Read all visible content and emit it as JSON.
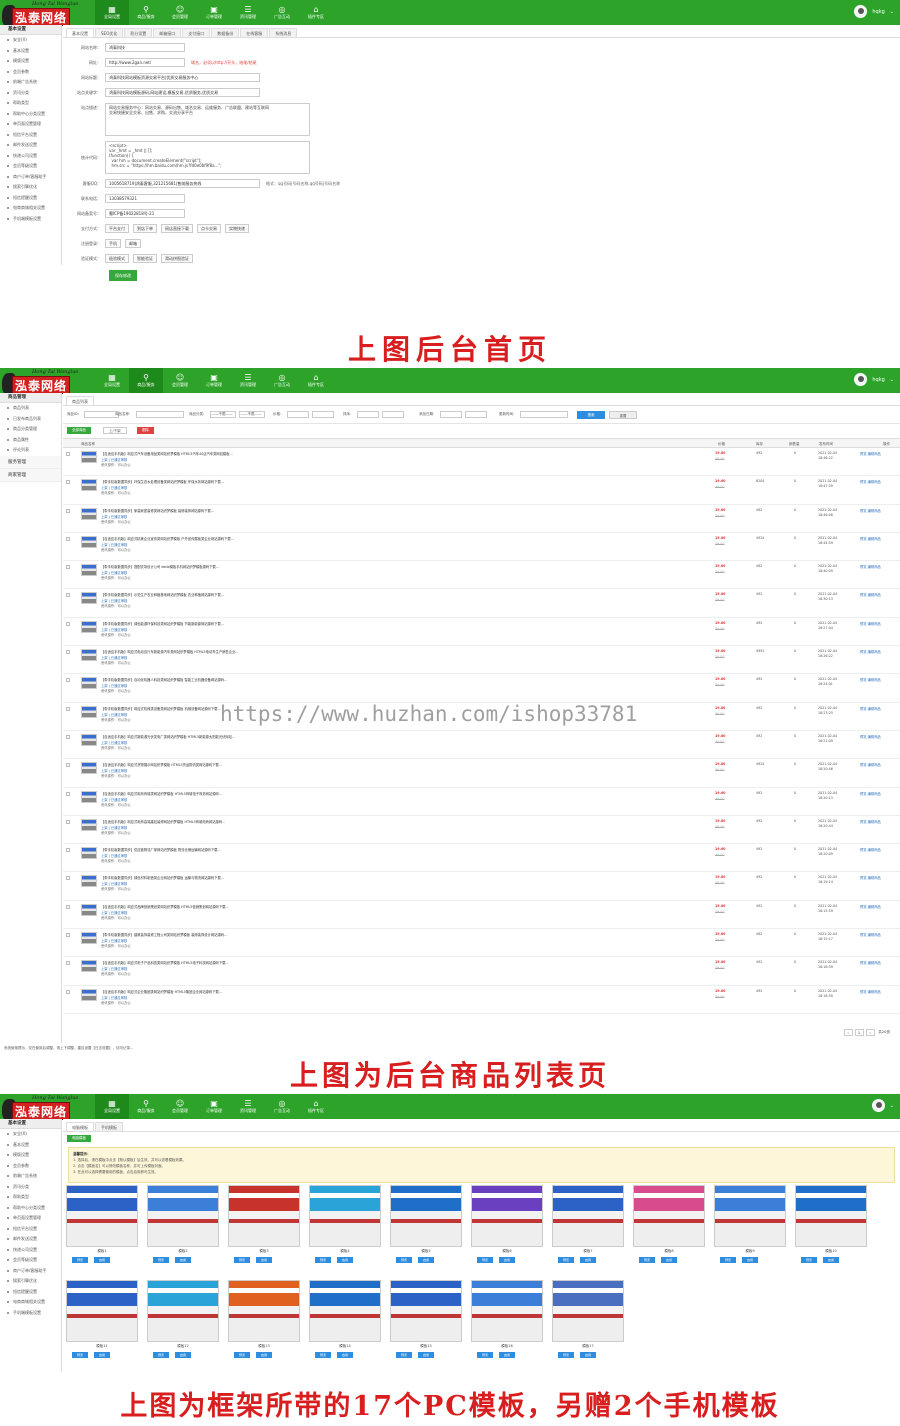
{
  "brand": {
    "kanji": "泓泰网络",
    "signature": "Hong Tai Wangluo"
  },
  "nav": [
    "全局设置",
    "商品/服务",
    "会员管理",
    "订单管理",
    "资讯管理",
    "广告互动",
    "插件专区"
  ],
  "user": {
    "name": "hqkg",
    "caret": "⌄"
  },
  "panel1": {
    "side_head": "基本设置",
    "side_items": [
      "安全(X)",
      "基本设置",
      "模版设置",
      "会员参数",
      "前端广告系统",
      "资讯分类",
      "帮助类型",
      "帮助中心分类设置",
      "单页面设置管理",
      "短信平台设置",
      "邮件发送设置",
      "快递公司设置",
      "会员等级设置",
      "商户订单/客服助手",
      "搜索引擎优化",
      "短信提醒设置",
      "电商商城相关设置",
      "手机端模板设置"
    ],
    "tabs": [
      "基本设置",
      "SEO优化",
      "积分设置",
      "邮箱接口",
      "支付接口",
      "数据备份",
      "在线客服",
      "系统消息"
    ],
    "fields": [
      {
        "label": "网站名称：",
        "value": "鸿泰科技"
      },
      {
        "label": "网址：",
        "value": "http://www.2gan.net/",
        "hint": "域名，必须以http://开头，结尾/结尾"
      },
      {
        "label": "网站标题：",
        "value": "鸿泰科技网站模板资源交易平台|优质交易服务中心"
      },
      {
        "label": "站点关键字：",
        "value": "鸿泰科技网站模板源码,网站建设,模板交易,优质服务,优质交易"
      }
    ],
    "desc_label": "站点描述：",
    "desc_value": "网站交易服务中心：网站交易、源码出售、域名交易、运维服务、广告联盟、建站等互联网\n交易快捷安全交易、出售、求购，交流分享平台",
    "stats_label": "统计代码：",
    "stats_value": "<script>\nvar _hmt = _hmt || [];\n(function() {\n  var hm = document.createElement(\"script\");\n  hm.src = \"https://hm.baidu.com/hm.js?fd0e0bf9f8a...\";",
    "qq": {
      "label": "客服QQ：",
      "value": "1005618719|鸿泰客服,321215681|售前服务热线",
      "note": "格式：qq号码|号码名称,qq号码|号码名称"
    },
    "phone": {
      "label": "联系电话：",
      "value": "13038579321"
    },
    "icp": {
      "label": "网站备案号：",
      "value": "蜀ICP备19022818号-21"
    },
    "options_label": "支付方式：",
    "options": [
      "平台支付",
      "到店下单",
      "网店直接下载",
      "点卡交易",
      "实物快递"
    ],
    "login_label": "注册登录：",
    "login_options": [
      "手机",
      "邮箱"
    ],
    "mode_label": "验证模式：",
    "mode_options": [
      "极验模式",
      "智能验证",
      "滑动拼图验证"
    ],
    "save": "保存修改"
  },
  "caption1": "上图后台首页",
  "panel2": {
    "side_head": "商品管理",
    "side_items": [
      "商品列表",
      "已发布商品列表",
      "商品分类管理",
      "商品属性",
      "评论列表"
    ],
    "side_cats": [
      "服务管理",
      "商家管理"
    ],
    "tab": "商品列表",
    "filters": [
      "商品ID：",
      "商品名称：",
      "商品分类：",
      "价格：",
      "排序：",
      "添加日期：",
      "更新时间："
    ],
    "category_placeholder": "——不限——",
    "search_btn": "搜索",
    "reset_btn": "重置",
    "actions": [
      "全部商品",
      "上/下架",
      "删除"
    ],
    "columns": [
      "商品名称",
      "价格",
      "库存",
      "销售量",
      "发布时间",
      "操作"
    ],
    "products": [
      {
        "title": "【自适应手机版】响应式汽车设备用品类网站织梦模板 HTML5汽车4S店汽车类网站模板...",
        "price": "19.00",
        "old": "39.00",
        "stock": "492",
        "sales": "0",
        "date": "2021-02-04",
        "time": "18:46:22"
      },
      {
        "title": "【带手机版数据同步】环保生态水处理设备类网站织梦模板 环保水务网站源码下载...",
        "price": "19.00",
        "old": "39.00",
        "stock": "6204",
        "sales": "0",
        "date": "2021-02-04",
        "time": "18:47:59"
      },
      {
        "title": "【带手机版数据同步】家装家居装修类网站织梦模板 装修装饰网站源码下载...",
        "price": "19.00",
        "old": "39.00",
        "stock": "492",
        "sales": "0",
        "date": "2021-02-04",
        "time": "18:46:08"
      },
      {
        "title": "【自适应手机版】响应式精美企业宣传类网站织梦模板 户外宣传展板类企业网站源码下载...",
        "price": "19.00",
        "old": "39.00",
        "stock": "4924",
        "sales": "0",
        "date": "2021-02-04",
        "time": "18:44:59"
      },
      {
        "title": "【带手机版数据同步】搭配农场设计公司 dede模板手机网站织梦模板源码下载...",
        "price": "19.00",
        "old": "39.00",
        "stock": "492",
        "sales": "0",
        "date": "2021-02-04",
        "time": "18:40:09"
      },
      {
        "title": "【带手机版数据同步】示范生产农业种植基地网站织梦模板 农业种植网站源码下载...",
        "price": "19.00",
        "old": "39.00",
        "stock": "492",
        "sales": "0",
        "date": "2021-02-04",
        "time": "18:30:13"
      },
      {
        "title": "【带手机版数据同步】绿色能源环保科技类网站织梦模板 节能新能源网站源码下载...",
        "price": "19.00",
        "old": "39.00",
        "stock": "492",
        "sales": "0",
        "date": "2021-02-04",
        "time": "18:27:04"
      },
      {
        "title": "【自适应手机版】响应式电动自行车新能源汽车类网站织梦模板 HTML5电动车生产销售企业...",
        "price": "19.00",
        "old": "39.00",
        "stock": "4991",
        "sales": "0",
        "date": "2021-02-04",
        "time": "18:26:22"
      },
      {
        "title": "【带手机版数据同步】自动化机器人科技类网站织梦模板 智能工业机器设备网站源码...",
        "price": "19.00",
        "old": "39.00",
        "stock": "492",
        "sales": "0",
        "date": "2021-02-04",
        "time": "18:24:01"
      },
      {
        "title": "【带手机版数据同步】响应式机械类设备类网站织梦模板 机械设备网站源码下载...",
        "price": "19.00",
        "old": "39.00",
        "stock": "492",
        "sales": "0",
        "date": "2021-02-04",
        "time": "18:23:25"
      },
      {
        "title": "【自适应手机版】响应式新能源光伏发电厂类网站织梦模板 HTML5新能源太阳能光伏网站...",
        "price": "19.00",
        "old": "39.00",
        "stock": "492",
        "sales": "0",
        "date": "2021-02-04",
        "time": "18:21:09"
      },
      {
        "title": "【自适应手机版】响应式货物展示网站织梦模板 HTML5货运物流类网站源码下载...",
        "price": "19.00",
        "old": "39.00",
        "stock": "4924",
        "sales": "0",
        "date": "2021-02-04",
        "time": "18:20:46"
      },
      {
        "title": "【自适应手机版】响应式电商商城类网站织梦模板 HTML5商城电子商务网站源码...",
        "price": "19.00",
        "old": "39.00",
        "stock": "492",
        "sales": "0",
        "date": "2021-02-04",
        "time": "18:20:13"
      },
      {
        "title": "【自适应手机版】响应式电商高端建站装修网站织梦模板 HTML5商城电商网站源码...",
        "price": "19.00",
        "old": "39.00",
        "stock": "492",
        "sales": "0",
        "date": "2021-02-04",
        "time": "18:20:44"
      },
      {
        "title": "【带手机版数据同步】供应链物流厂家网站织梦模板 物流仓储运输网站源码下载...",
        "price": "19.00",
        "old": "39.00",
        "stock": "492",
        "sales": "0",
        "date": "2021-02-04",
        "time": "18:20:09"
      },
      {
        "title": "【带手机版数据同步】绿色材料制造类企业网站织梦模板 运输与物流网站源码下载...",
        "price": "19.00",
        "old": "39.00",
        "stock": "492",
        "sales": "0",
        "date": "2021-02-04",
        "time": "18:19:14"
      },
      {
        "title": "【自适应手机版】响应式品牌营销策划类网站织梦模板 HTML5营销策划网站源码下载...",
        "price": "19.00",
        "old": "39.00",
        "stock": "492",
        "sales": "0",
        "date": "2021-02-04",
        "time": "18:15:59"
      },
      {
        "title": "【带手机版数据同步】建筑装饰装修工程公司类网站织梦模板 装修装饰设计网站源码...",
        "price": "19.00",
        "old": "39.00",
        "stock": "492",
        "sales": "0",
        "date": "2021-02-04",
        "time": "18:15:17"
      },
      {
        "title": "【自适应手机版】响应式电子产品科技类网站织梦模板 HTML5电子科技网站源码下载...",
        "price": "19.00",
        "old": "39.00",
        "stock": "492",
        "sales": "0",
        "date": "2021-02-04",
        "time": "18:18:59"
      },
      {
        "title": "【自适应手机版】响应式企业集团类网站织梦模板 HTML5集团企业网站源码下载...",
        "price": "19.00",
        "old": "39.00",
        "stock": "492",
        "sales": "0",
        "date": "2021-02-04",
        "time": "18:18:59"
      }
    ],
    "row_link": "上架 | 已通过审核",
    "row_op": "资讯操作：可以办公",
    "row_actions": "预览  编辑商品",
    "pager": [
      "‹",
      "1",
      "›"
    ],
    "pager_info": "共20页",
    "footer": "系统使用提示，仅在使用后调整，请上下调整，建议设置【日志设置】，访问记录..."
  },
  "caption2": "上图为后台商品列表页",
  "watermark": "https://www.huzhan.com/ishop33781",
  "panel3": {
    "side_head": "基本设置",
    "side_items": [
      "安全(X)",
      "基本设置",
      "模版设置",
      "会员参数",
      "前端广告系统",
      "资讯分类",
      "帮助类型",
      "帮助中心分类设置",
      "单页面设置管理",
      "短信平台设置",
      "邮件发送设置",
      "快递公司设置",
      "会员等级设置",
      "商户订单/客服助手",
      "搜索引擎优化",
      "短信提醒设置",
      "电商商城相关设置",
      "手机端模板设置"
    ],
    "tabs": [
      "电脑模板",
      "手机模板"
    ],
    "sub_tab": "电脑模板",
    "tips": [
      "温馨提示：",
      "1. 选择后，请在模板中点击【默认模板】后生效，并可以查看模板效果。",
      "2. 点击【模板名】可以修改模板名称，并可上传模板封面。",
      "3. 在此可以选择需要使用的模板，点击启用即可生效。"
    ],
    "template_btns": [
      "预览",
      "启用"
    ],
    "templates": [
      "模板1",
      "模板2",
      "模板3",
      "模板4",
      "模板5",
      "模板6",
      "模板7",
      "模板8",
      "模板9",
      "模板10",
      "模板11",
      "模板12",
      "模板13",
      "模板14",
      "模板15",
      "模板16",
      "模板17"
    ]
  },
  "caption3": "上图为框架所带的17个PC模板，另赠2个手机模板",
  "colors": {
    "green": "#2ea32a",
    "red": "#d81e1e",
    "blue": "#2f8de0"
  }
}
